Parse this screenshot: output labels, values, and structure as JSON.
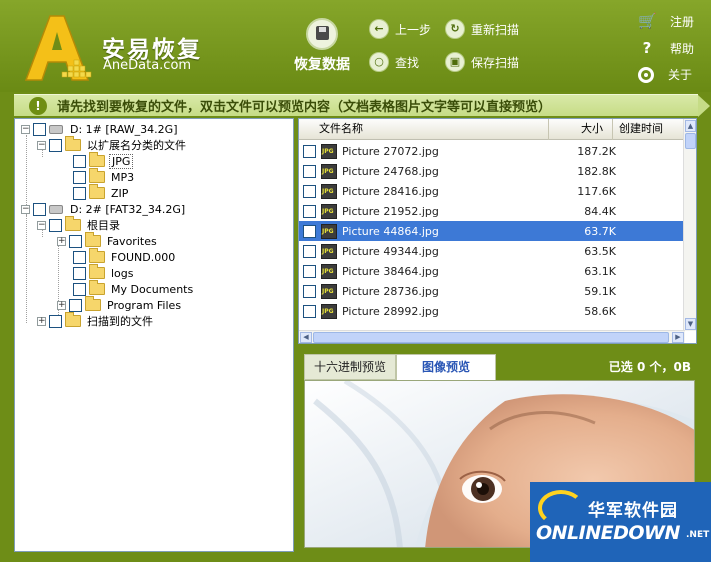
{
  "header": {
    "brand_cn": "安易恢复",
    "brand_en": "AneData.com",
    "recover_label": "恢复数据",
    "toolbar": [
      {
        "label": "上一步",
        "icon": "back-arrow-icon"
      },
      {
        "label": "重新扫描",
        "icon": "rescan-icon"
      },
      {
        "label": "查找",
        "icon": "search-icon"
      },
      {
        "label": "保存扫描",
        "icon": "save-scan-icon"
      }
    ],
    "right_menu": [
      {
        "label": "注册",
        "icon": "cart-icon"
      },
      {
        "label": "帮助",
        "icon": "help-icon"
      },
      {
        "label": "关于",
        "icon": "about-icon"
      }
    ]
  },
  "notice": "请先找到要恢复的文件，双击文件可以预览内容（文档表格图片文字等可以直接预览）",
  "tree": [
    {
      "label": "D:  1# [RAW_34.2G]"
    },
    {
      "label": "以扩展名分类的文件"
    },
    {
      "label": "JPG"
    },
    {
      "label": "MP3"
    },
    {
      "label": "ZIP"
    },
    {
      "label": "D:  2# [FAT32_34.2G]"
    },
    {
      "label": "根目录"
    },
    {
      "label": "Favorites"
    },
    {
      "label": "FOUND.000"
    },
    {
      "label": "logs"
    },
    {
      "label": "My Documents"
    },
    {
      "label": "Program Files"
    },
    {
      "label": "扫描到的文件"
    }
  ],
  "file_list": {
    "columns": [
      "文件名称",
      "大小",
      "创建时间"
    ],
    "rows": [
      {
        "name": "Picture 27072.jpg",
        "size": "187.2K"
      },
      {
        "name": "Picture 24768.jpg",
        "size": "182.8K"
      },
      {
        "name": "Picture 28416.jpg",
        "size": "117.6K"
      },
      {
        "name": "Picture 21952.jpg",
        "size": "84.4K"
      },
      {
        "name": "Picture 44864.jpg",
        "size": "63.7K",
        "selected": true
      },
      {
        "name": "Picture 49344.jpg",
        "size": "63.5K"
      },
      {
        "name": "Picture 38464.jpg",
        "size": "63.1K"
      },
      {
        "name": "Picture 28736.jpg",
        "size": "59.1K"
      },
      {
        "name": "Picture 28992.jpg",
        "size": "58.6K"
      }
    ]
  },
  "preview": {
    "tabs": [
      "十六进制预览",
      "图像预览"
    ],
    "active_tab": "图像预览",
    "selection_info": "已选 0 个，0B"
  },
  "watermark": {
    "cn": "华军软件园",
    "en": "ONLINEDOWN",
    "suffix": ".NET"
  },
  "colors": {
    "theme_green": "#6e8d17",
    "notice_bg": "#c6dc86",
    "selected_row": "#3d79d6",
    "watermark_blue": "#1f64b8"
  }
}
